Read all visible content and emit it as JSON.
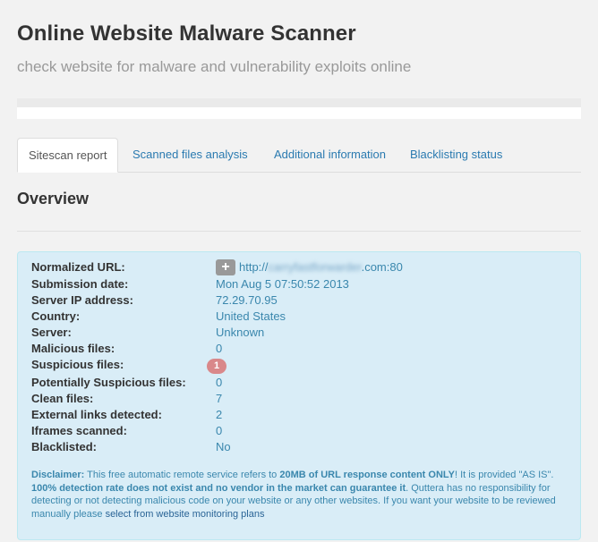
{
  "page": {
    "title": "Online Website Malware Scanner",
    "subtitle": "check website for malware and vulnerability exploits online"
  },
  "progress": {
    "fraction": 1.0
  },
  "tabs": [
    {
      "label": "Sitescan report",
      "active": true
    },
    {
      "label": "Scanned files analysis",
      "active": false
    },
    {
      "label": "Additional information",
      "active": false
    },
    {
      "label": "Blacklisting status",
      "active": false
    }
  ],
  "overview": {
    "title": "Overview",
    "url_prefix": "http://",
    "url_blurred": "carryfastforwarder",
    "url_suffix": ".com:80",
    "rows": [
      {
        "label": "Normalized URL:"
      },
      {
        "label": "Submission date:",
        "value": "Mon Aug 5 07:50:52 2013"
      },
      {
        "label": "Server IP address:",
        "value": "72.29.70.95"
      },
      {
        "label": "Country:",
        "value": "United States"
      },
      {
        "label": "Server:",
        "value": "Unknown"
      },
      {
        "label": "Malicious files:",
        "value": "0"
      },
      {
        "label": "Suspicious files:",
        "value": "1"
      },
      {
        "label": "Potentially Suspicious files:",
        "value": "0"
      },
      {
        "label": "Clean files:",
        "value": "7"
      },
      {
        "label": "External links detected:",
        "value": "2"
      },
      {
        "label": "Iframes scanned:",
        "value": "0"
      },
      {
        "label": "Blacklisted:",
        "value": "No"
      }
    ]
  },
  "disclaimer": {
    "label": "Disclaimer:",
    "text1": " This free automatic remote service refers to ",
    "bold1": "20MB of URL response content ONLY",
    "text2": "! It is provided \"AS IS\". ",
    "bold2": "100% detection rate does not exist and no vendor in the market can guarantee it",
    "text3": ". Quttera has no responsibility for detecting or not detecting malicious code on your website or any other websites. If you want your website to be reviewed manually please ",
    "link": "select from website monitoring plans"
  },
  "colors": {
    "info_bg": "#d9edf7",
    "info_text": "#3a87ad",
    "badge": "#d9888a",
    "link": "#2a7ab0"
  }
}
